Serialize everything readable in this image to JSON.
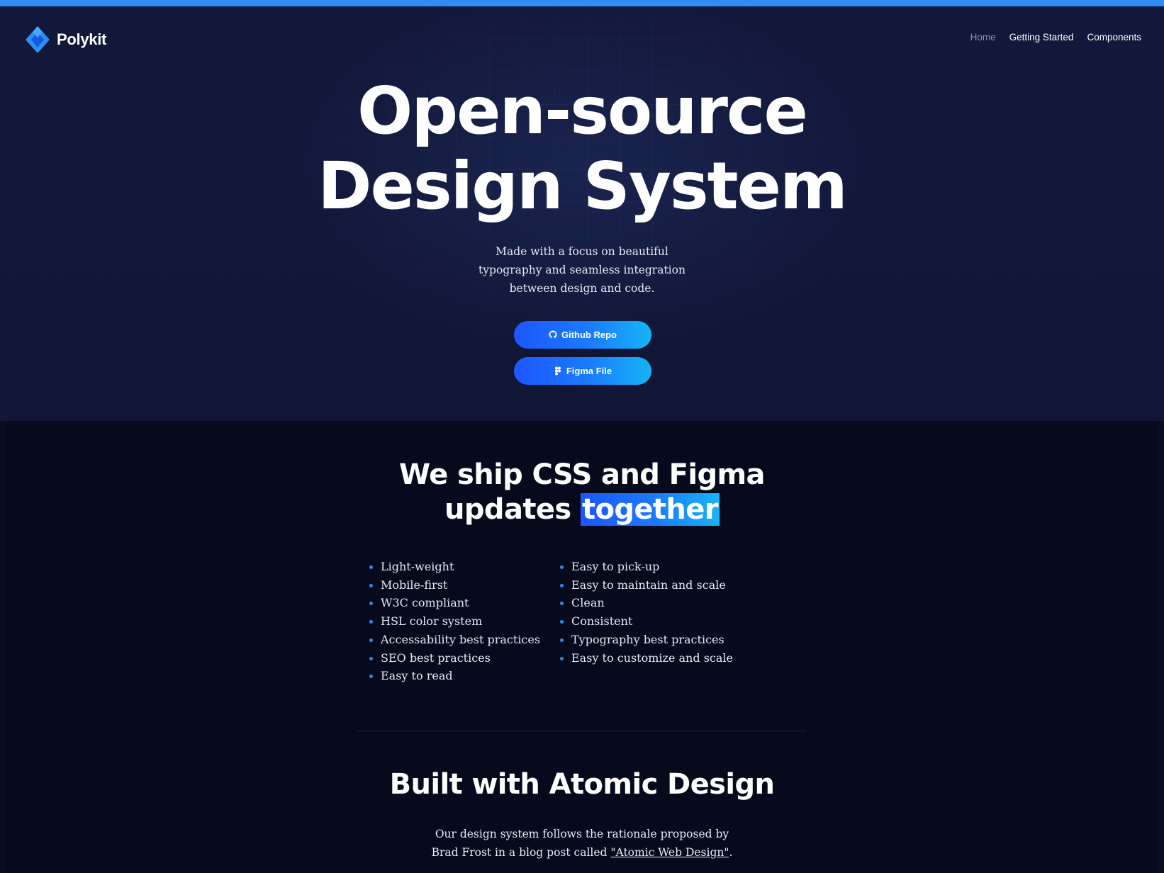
{
  "brand": {
    "name": "Polykit"
  },
  "nav": {
    "items": [
      {
        "label": "Home",
        "active": true
      },
      {
        "label": "Getting Started",
        "active": false
      },
      {
        "label": "Components",
        "active": false
      }
    ]
  },
  "hero": {
    "title_line1": "Open-source",
    "title_line2": "Design System",
    "subtitle_line1": "Made with a focus on beautiful",
    "subtitle_line2": "typography and seamless integration",
    "subtitle_line3": "between design and code.",
    "buttons": [
      {
        "label": "Github Repo",
        "icon": "github-icon"
      },
      {
        "label": "Figma File",
        "icon": "figma-icon"
      }
    ]
  },
  "features": {
    "heading_line1": "We ship CSS and Figma",
    "heading_line2_prefix": "updates ",
    "heading_highlight": "together",
    "left_list": [
      "Light-weight",
      "Mobile-first",
      "W3C compliant",
      "HSL color system",
      "Accessability best practices",
      "SEO best practices",
      "Easy to read"
    ],
    "right_list": [
      "Easy to pick-up",
      "Easy to maintain and scale",
      "Clean",
      "Consistent",
      "Typography best practices",
      "Easy to customize and scale"
    ]
  },
  "atomic": {
    "heading": "Built with Atomic Design",
    "text_line1": "Our design system follows the rationale proposed by",
    "text_line2_prefix": "Brad Frost in a blog post called ",
    "link_text": "\"Atomic Web Design\"",
    "text_line2_suffix": "."
  },
  "colors": {
    "accent": "#2f8ff0",
    "button_gradient_start": "#1d56ff",
    "button_gradient_end": "#17b4f7",
    "hero_bg": "#12183a",
    "section_bg": "#070a1d"
  }
}
